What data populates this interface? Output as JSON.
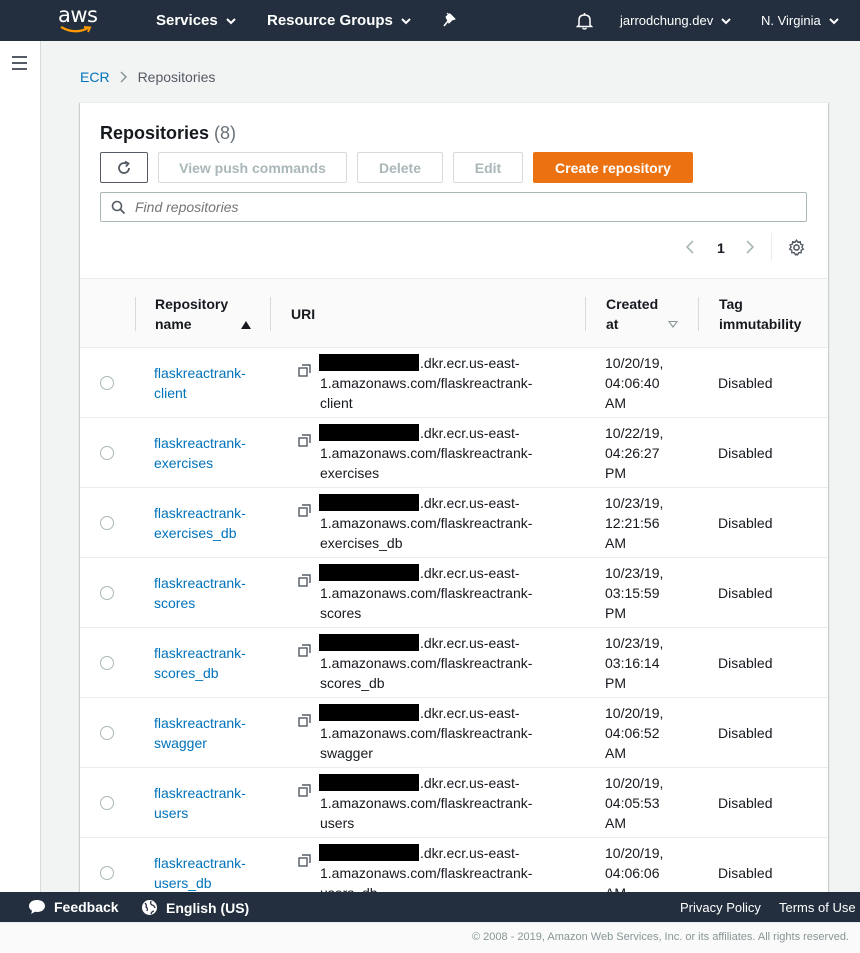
{
  "topnav": {
    "logo": "aws",
    "services": "Services",
    "resource_groups": "Resource Groups",
    "account": "jarrodchung.dev",
    "region": "N. Virginia"
  },
  "breadcrumb": {
    "root": "ECR",
    "current": "Repositories"
  },
  "panel": {
    "title": "Repositories",
    "count": "(8)",
    "buttons": {
      "push": "View push commands",
      "delete": "Delete",
      "edit": "Edit",
      "create": "Create repository"
    },
    "search_placeholder": "Find repositories",
    "page": "1"
  },
  "columns": {
    "name_line1": "Repository",
    "name_line2": "name",
    "uri": "URI",
    "created_line1": "Created",
    "created_line2": "at",
    "tag_line1": "Tag",
    "tag_line2": "immutability"
  },
  "rows": [
    {
      "name1": "flaskreactrank-",
      "name2": "client",
      "uri1": ".dkr.ecr.us-east-",
      "uri2": "1.amazonaws.com/flaskreactrank-",
      "uri3": "client",
      "c1": "10/20/19,",
      "c2": "04:06:40",
      "c3": "AM",
      "tag": "Disabled"
    },
    {
      "name1": "flaskreactrank-",
      "name2": "exercises",
      "uri1": ".dkr.ecr.us-east-",
      "uri2": "1.amazonaws.com/flaskreactrank-",
      "uri3": "exercises",
      "c1": "10/22/19,",
      "c2": "04:26:27",
      "c3": "PM",
      "tag": "Disabled"
    },
    {
      "name1": "flaskreactrank-",
      "name2": "exercises_db",
      "uri1": ".dkr.ecr.us-east-",
      "uri2": "1.amazonaws.com/flaskreactrank-",
      "uri3": "exercises_db",
      "c1": "10/23/19,",
      "c2": "12:21:56",
      "c3": "AM",
      "tag": "Disabled"
    },
    {
      "name1": "flaskreactrank-",
      "name2": "scores",
      "uri1": ".dkr.ecr.us-east-",
      "uri2": "1.amazonaws.com/flaskreactrank-",
      "uri3": "scores",
      "c1": "10/23/19,",
      "c2": "03:15:59",
      "c3": "PM",
      "tag": "Disabled"
    },
    {
      "name1": "flaskreactrank-",
      "name2": "scores_db",
      "uri1": ".dkr.ecr.us-east-",
      "uri2": "1.amazonaws.com/flaskreactrank-",
      "uri3": "scores_db",
      "c1": "10/23/19,",
      "c2": "03:16:14",
      "c3": "PM",
      "tag": "Disabled"
    },
    {
      "name1": "flaskreactrank-",
      "name2": "swagger",
      "uri1": ".dkr.ecr.us-east-",
      "uri2": "1.amazonaws.com/flaskreactrank-",
      "uri3": "swagger",
      "c1": "10/20/19,",
      "c2": "04:06:52",
      "c3": "AM",
      "tag": "Disabled"
    },
    {
      "name1": "flaskreactrank-",
      "name2": "users",
      "uri1": ".dkr.ecr.us-east-",
      "uri2": "1.amazonaws.com/flaskreactrank-",
      "uri3": "users",
      "c1": "10/20/19,",
      "c2": "04:05:53",
      "c3": "AM",
      "tag": "Disabled"
    },
    {
      "name1": "flaskreactrank-",
      "name2": "users_db",
      "uri1": ".dkr.ecr.us-east-",
      "uri2": "1.amazonaws.com/flaskreactrank-",
      "uri3": "users_db",
      "c1": "10/20/19,",
      "c2": "04:06:06",
      "c3": "AM",
      "tag": "Disabled"
    }
  ],
  "footer": {
    "feedback": "Feedback",
    "language": "English (US)",
    "privacy": "Privacy Policy",
    "terms": "Terms of Use",
    "copyright": "© 2008 - 2019, Amazon Web Services, Inc. or its affiliates. All rights reserved."
  },
  "colors": {
    "nav_bg": "#232f3e",
    "link": "#0073bb",
    "primary_button": "#ec7211"
  },
  "icons": [
    "aws-smile-icon",
    "caret-down-icon",
    "pin-icon",
    "bell-icon",
    "hamburger-icon",
    "chevron-right-icon",
    "refresh-icon",
    "search-icon",
    "chevron-left-icon",
    "gear-icon",
    "copy-icon",
    "feedback-icon",
    "globe-icon"
  ]
}
